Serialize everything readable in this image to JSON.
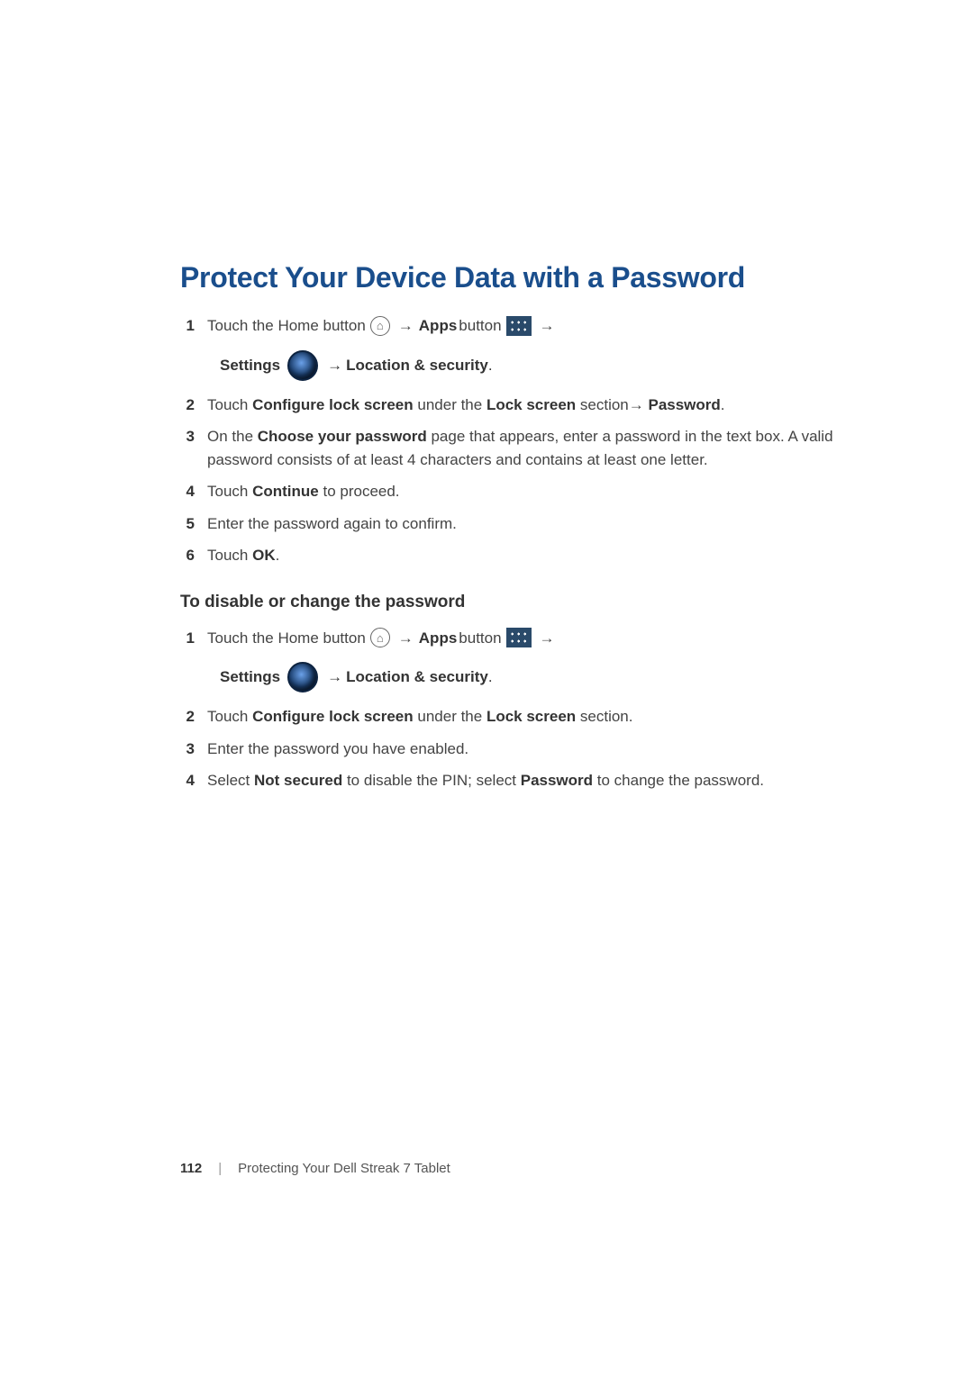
{
  "heading": "Protect Your Device Data with a Password",
  "labels": {
    "touch_home": "Touch the Home button",
    "apps": "Apps",
    "button": "button",
    "settings": "Settings",
    "location_security": "Location & security",
    "arrow": "→"
  },
  "steps_a": {
    "s2_a": "Touch ",
    "s2_b": "Configure lock screen",
    "s2_c": " under the ",
    "s2_d": "Lock screen",
    "s2_e": " section→ ",
    "s2_f": "Password",
    "s2_g": ".",
    "s3_a": "On the ",
    "s3_b": "Choose your password",
    "s3_c": " page that appears, enter a password in the text box. A valid password consists of at least 4 characters and contains at least one letter.",
    "s4_a": "Touch ",
    "s4_b": "Continue",
    "s4_c": " to proceed.",
    "s5": "Enter the password again to confirm.",
    "s6_a": "Touch ",
    "s6_b": "OK",
    "s6_c": "."
  },
  "subheading": "To disable or change the password",
  "steps_b": {
    "s2_a": "Touch ",
    "s2_b": "Configure lock screen",
    "s2_c": " under the ",
    "s2_d": "Lock screen",
    "s2_e": " section.",
    "s3": "Enter the password you have enabled.",
    "s4_a": "Select ",
    "s4_b": "Not secured",
    "s4_c": " to disable the PIN; select ",
    "s4_d": "Password",
    "s4_e": " to change the password."
  },
  "footer": {
    "page_num": "112",
    "divider": "|",
    "chapter": "Protecting Your Dell Streak 7 Tablet"
  },
  "nums": {
    "1": "1",
    "2": "2",
    "3": "3",
    "4": "4",
    "5": "5",
    "6": "6"
  }
}
